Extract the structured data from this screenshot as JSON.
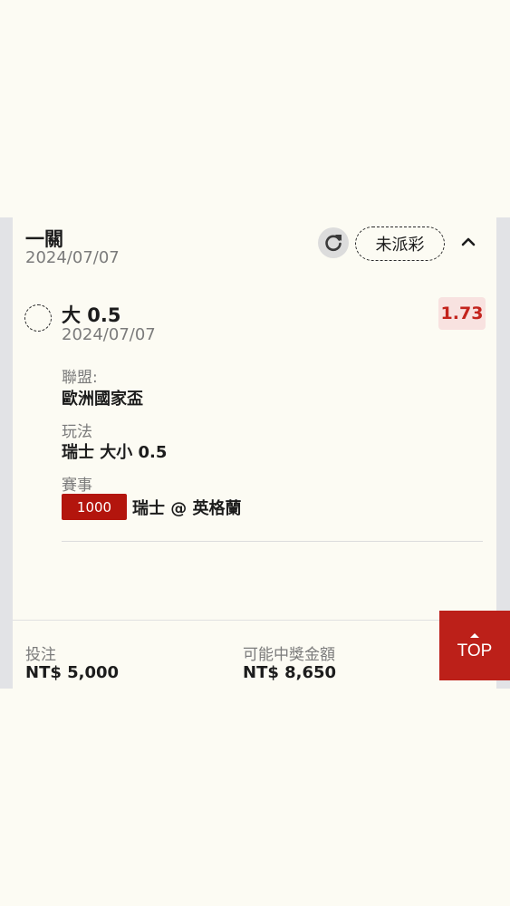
{
  "parlay": {
    "title": "一關",
    "date": "2024/07/07",
    "status_label": "未派彩"
  },
  "bet": {
    "pick": "大 0.5",
    "date": "2024/07/07",
    "odds": "1.73",
    "league_label": "聯盟:",
    "league_value": "歐洲國家盃",
    "play_label": "玩法",
    "play_value": "瑞士 大小 0.5",
    "event_label": "賽事",
    "match_id": "1000",
    "match_name": "瑞士 @ 英格蘭"
  },
  "footer": {
    "stake_label": "投注",
    "stake_value": "NT$ 5,000",
    "potential_label": "可能中獎金額",
    "potential_value": "NT$ 8,650"
  },
  "top_button": {
    "label": "TOP"
  },
  "icons": {
    "refresh": "refresh-icon",
    "chevron": "chevron-up-icon",
    "top_arrow": "arrow-up-icon"
  },
  "colors": {
    "background": "#fcfbf3",
    "accent_red": "#bc2019",
    "odds_text": "#c3241d",
    "odds_bg": "#f8e2e0"
  }
}
